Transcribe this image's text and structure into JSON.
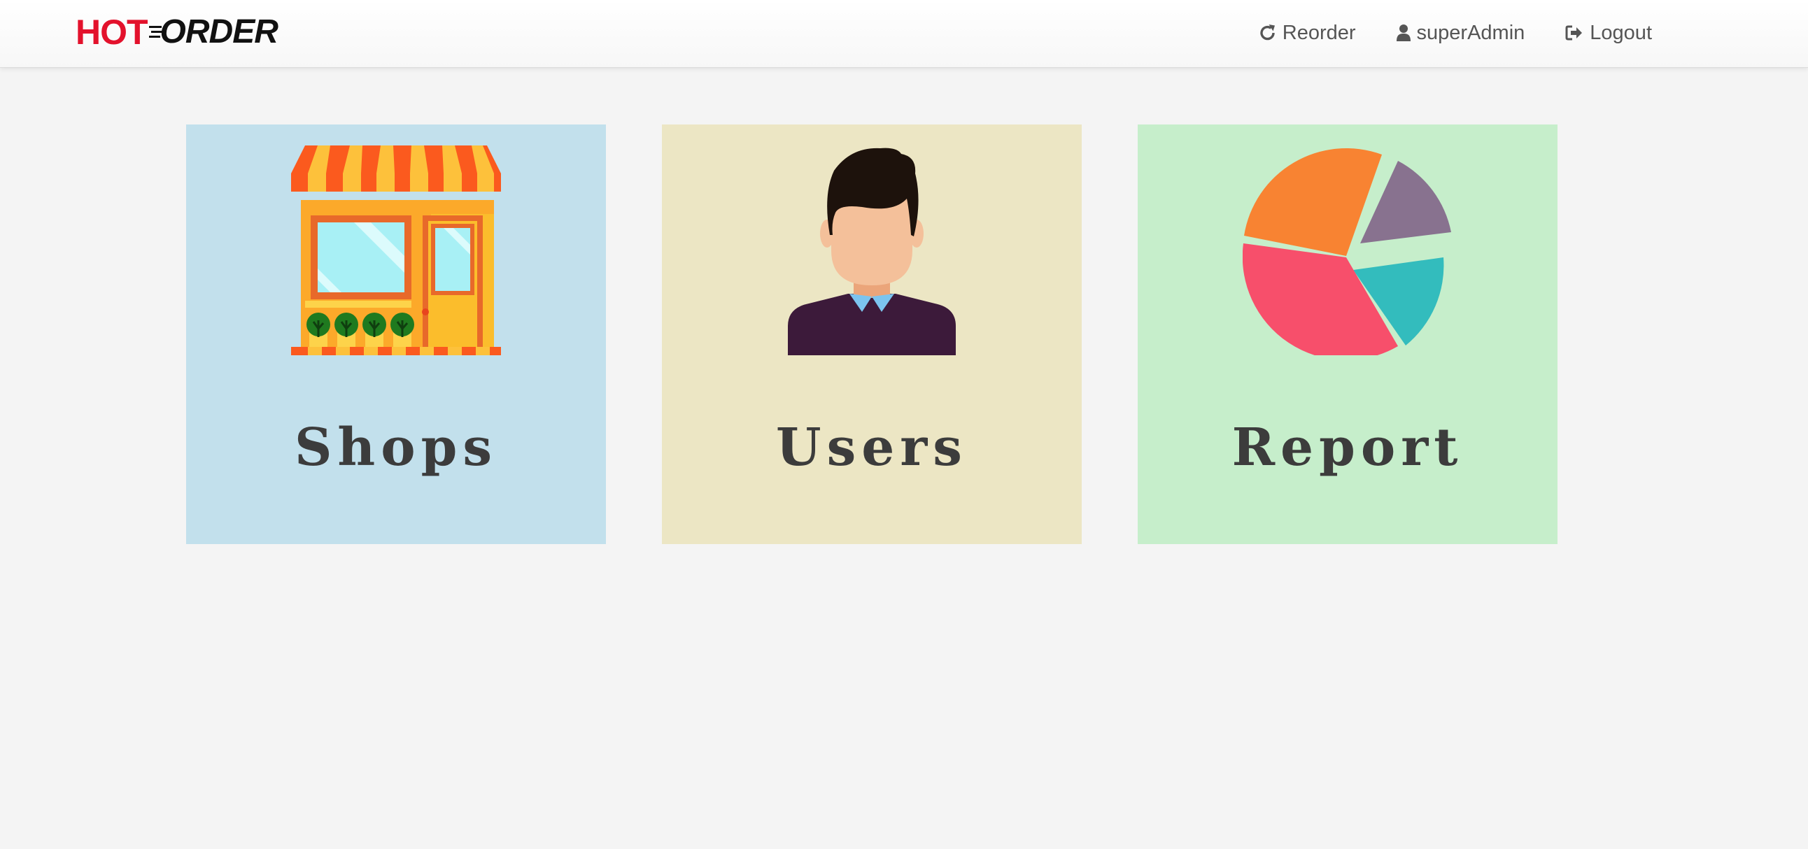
{
  "navbar": {
    "brand": {
      "part1": "HOT",
      "part2": "ORDER",
      "colors": {
        "part1": "#e3122c",
        "part2": "#111111"
      }
    },
    "links": [
      {
        "label": "Reorder",
        "icon": "refresh-icon"
      },
      {
        "label": "superAdmin",
        "icon": "user-icon"
      },
      {
        "label": "Logout",
        "icon": "logout-icon"
      }
    ]
  },
  "tiles": [
    {
      "label": "Shops",
      "icon": "shop-icon",
      "background": "#c2e0ec"
    },
    {
      "label": "Users",
      "icon": "user-avatar-icon",
      "background": "#ece6c4"
    },
    {
      "label": "Report",
      "icon": "pie-chart-icon",
      "background": "#c6eecb"
    }
  ]
}
